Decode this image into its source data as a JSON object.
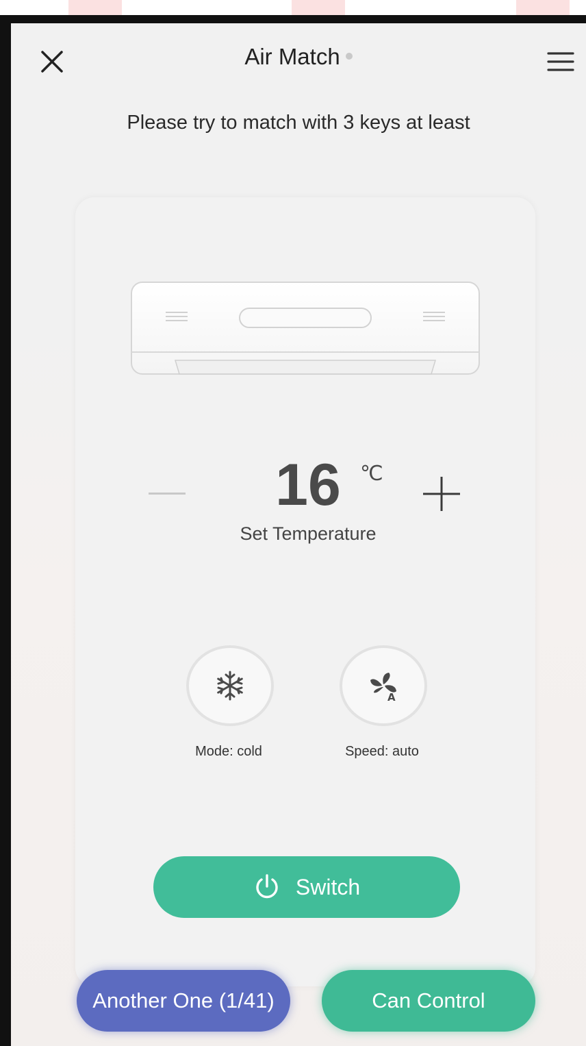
{
  "header": {
    "title": "Air Match",
    "close_icon": "close-icon",
    "menu_icon": "hamburger-menu-icon"
  },
  "instruction": "Please try to match with 3 keys at least",
  "temperature": {
    "value": "16",
    "unit": "℃",
    "label": "Set Temperature"
  },
  "modes": {
    "cold_label": "Mode: cold",
    "speed_label": "Speed: auto"
  },
  "switch": {
    "label": "Switch"
  },
  "footer": {
    "another_label": "Another One (1/41)",
    "control_label": "Can Control"
  },
  "colors": {
    "accent_green": "#41bd99",
    "accent_blue": "#5c6bc0",
    "background": "#f1f1f1"
  }
}
